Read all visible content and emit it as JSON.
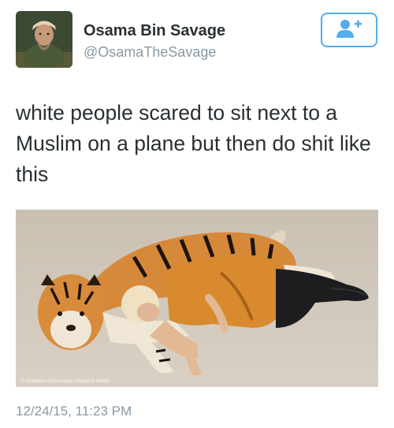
{
  "user": {
    "display_name": "Osama Bin Savage",
    "handle": "@OsamaTheSavage"
  },
  "follow_button": {
    "icon": "add-user-icon",
    "color": "#55acee"
  },
  "tweet": {
    "text": "white people scared to sit next to a Muslim on a plane but then do shit like this",
    "timestamp": "12/24/15, 11:23 PM",
    "media_watermark": "© Australian Cornerstone Research Media"
  },
  "colors": {
    "accent": "#55acee",
    "text": "#292f33",
    "muted": "#8899a6"
  }
}
